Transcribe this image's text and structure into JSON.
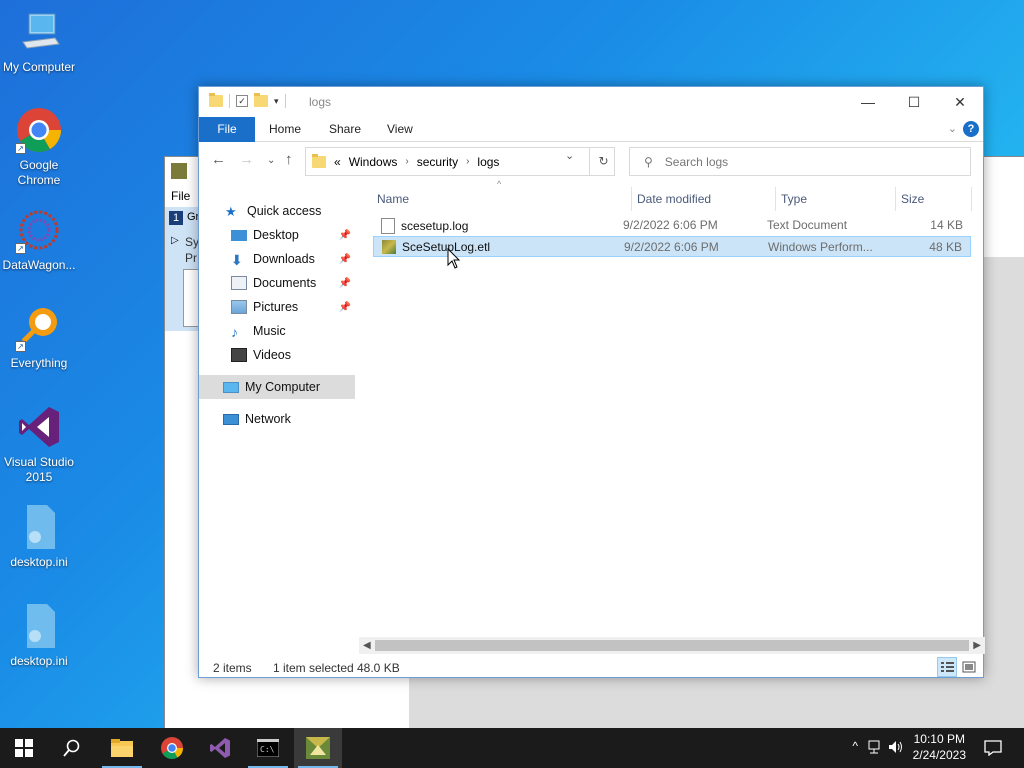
{
  "desktop": {
    "icons": [
      {
        "label": "My Computer"
      },
      {
        "label": "Google Chrome"
      },
      {
        "label": "DataWagon..."
      },
      {
        "label": "Everything"
      },
      {
        "label": "Visual Studio 2015"
      },
      {
        "label": "desktop.ini"
      },
      {
        "label": "desktop.ini"
      }
    ]
  },
  "bg_window": {
    "menu": "File",
    "tree_item": "1",
    "tree_item2": "Gr",
    "tree_label": "Sy",
    "tree_label2": "Pr"
  },
  "explorer": {
    "title": "logs",
    "ribbon_tabs": [
      "File",
      "Home",
      "Share",
      "View"
    ],
    "address": {
      "prefix": "«",
      "crumbs": [
        "Windows",
        "security",
        "logs"
      ]
    },
    "search_placeholder": "Search logs",
    "nav": [
      {
        "label": "Quick access",
        "icon": "star-icon"
      },
      {
        "label": "Desktop",
        "icon": "desktop-folder-icon",
        "pinned": true
      },
      {
        "label": "Downloads",
        "icon": "download-icon",
        "pinned": true
      },
      {
        "label": "Documents",
        "icon": "documents-icon",
        "pinned": true
      },
      {
        "label": "Pictures",
        "icon": "pictures-icon",
        "pinned": true
      },
      {
        "label": "Music",
        "icon": "music-icon"
      },
      {
        "label": "Videos",
        "icon": "videos-icon"
      },
      {
        "label": "My Computer",
        "icon": "computer-icon",
        "selected": true
      },
      {
        "label": "Network",
        "icon": "network-icon"
      }
    ],
    "columns": [
      "Name",
      "Date modified",
      "Type",
      "Size"
    ],
    "files": [
      {
        "name": "scesetup.log",
        "date": "9/2/2022 6:06 PM",
        "type": "Text Document",
        "size": "14 KB",
        "selected": false
      },
      {
        "name": "SceSetupLog.etl",
        "date": "9/2/2022 6:06 PM",
        "type": "Windows Perform...",
        "size": "48 KB",
        "selected": true
      }
    ],
    "status": {
      "items": "2 items",
      "selected": "1 item selected",
      "size": "48.0 KB"
    }
  },
  "taskbar": {
    "time": "10:10 PM",
    "date": "2/24/2023"
  },
  "colors": {
    "accent": "#1a6fc9",
    "selection": "#cce4f7",
    "taskbar": "#1b1b1b"
  }
}
